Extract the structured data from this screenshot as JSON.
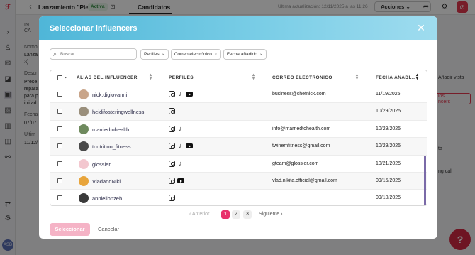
{
  "app": {
    "campaign_title": "Lanzamiento \"Pie...",
    "status_badge": "Activa",
    "tab_candidates": "Candidatos",
    "last_update": "Última actualización: 12/11/2025 a las 11:26",
    "actions_label": "Acciones",
    "avatar_initials": "ASB",
    "left_fragments": [
      "IN",
      "CA",
      "Nomb",
      "Lanza",
      "3)",
      "Descr",
      "Prese",
      "repara",
      "para p",
      "irritad",
      "Fecha",
      "07/07",
      "Últim",
      "11/12/"
    ],
    "right_fragments": [
      "Añadir vista",
      "los",
      "ncers",
      "ta",
      "ng call"
    ]
  },
  "modal": {
    "title": "Seleccionar influencers",
    "search_placeholder": "Buscar",
    "filters": [
      "Perfiles",
      "Correo electrónico",
      "Fecha añadido"
    ],
    "columns": {
      "alias": "ALIAS DEL INFLUENCER",
      "profiles": "PERFILES",
      "email": "CORREO ELECTRÓNICO",
      "date": "FECHA AÑADI..."
    },
    "rows": [
      {
        "alias": "nick.digiovanni",
        "platforms": [
          "instagram",
          "tiktok",
          "youtube"
        ],
        "email": "business@chefnick.com",
        "date": "11/19/2025",
        "avatar_color": "#c9a58a"
      },
      {
        "alias": "heidifosteringwellness",
        "platforms": [
          "instagram"
        ],
        "email": "",
        "date": "10/29/2025",
        "avatar_color": "#9a8f7c"
      },
      {
        "alias": "marriedtohealth",
        "platforms": [
          "instagram",
          "tiktok"
        ],
        "email": "info@marriedtohealth.com",
        "date": "10/29/2025",
        "avatar_color": "#6f8a5e"
      },
      {
        "alias": "tnutrition_fitness",
        "platforms": [
          "instagram",
          "tiktok",
          "youtube"
        ],
        "email": "twinemfitness@gmail.com",
        "date": "10/29/2025",
        "avatar_color": "#4a4a4a"
      },
      {
        "alias": "glossier",
        "platforms": [
          "instagram",
          "tiktok"
        ],
        "email": "gteam@glossier.com",
        "date": "10/21/2025",
        "avatar_color": "#f3c7cf"
      },
      {
        "alias": "VladandNiki",
        "platforms": [
          "instagram",
          "youtube"
        ],
        "email": "vlad.nikita.official@gmail.com",
        "date": "09/15/2025",
        "avatar_color": "#e8a53c"
      },
      {
        "alias": "annieilonzeh",
        "platforms": [
          "instagram"
        ],
        "email": "",
        "date": "09/10/2025",
        "avatar_color": "#3b3b3b"
      }
    ],
    "pagination": {
      "prev": "Anterior",
      "pages": [
        "1",
        "2",
        "3"
      ],
      "current": "1",
      "next": "Siguiente"
    },
    "buttons": {
      "select": "Seleccionar",
      "cancel": "Cancelar"
    }
  },
  "colors": {
    "header_gradient_start": "#4fb6d8",
    "accent_pink": "#e8316b",
    "select_button_disabled": "#f5b3c6"
  }
}
